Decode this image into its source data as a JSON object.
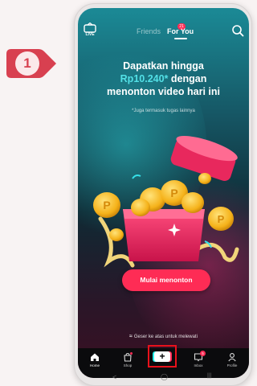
{
  "step": {
    "number": "1",
    "color": "#d84050"
  },
  "top_bar": {
    "live_label": "LIVE",
    "friends_tab": "Friends",
    "friends_badge": "21",
    "for_you_tab": "For You",
    "search_icon": "search-icon"
  },
  "promo": {
    "headline_line1": "Dapatkan hingga",
    "amount": "Rp10.240*",
    "headline_line2_suffix": " dengan",
    "headline_line3": "menonton video hari ini",
    "subnote": "*Juga termasuk tugas lainnya",
    "cta_label": "Mulai menonton",
    "swipe_hint": "Geser ke atas untuk melewati"
  },
  "nav": {
    "items": [
      {
        "label": "Home",
        "icon": "home-icon"
      },
      {
        "label": "Shop",
        "icon": "shop-icon"
      },
      {
        "label": "",
        "icon": "create-icon"
      },
      {
        "label": "Inbox",
        "icon": "inbox-icon",
        "badge": "5"
      },
      {
        "label": "Profile",
        "icon": "profile-icon"
      }
    ]
  },
  "system_nav": {
    "back": "<",
    "home": "◯",
    "recents": "|||"
  },
  "colors": {
    "accent": "#fe2c55",
    "amount": "#52e0e6",
    "highlight_box": "#e8111b"
  }
}
